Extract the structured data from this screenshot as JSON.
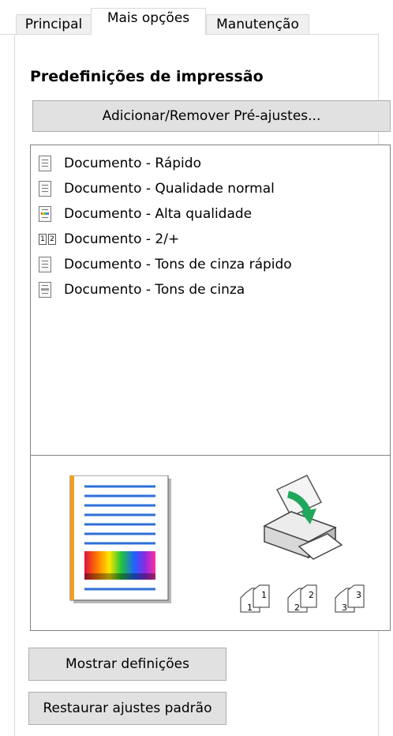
{
  "tabs": [
    {
      "label": "Principal",
      "active": false
    },
    {
      "label": "Mais opções",
      "active": true
    },
    {
      "label": "Manutenção",
      "active": false
    }
  ],
  "presets": {
    "title": "Predefinições de impressão",
    "add_remove_label": "Adicionar/Remover Pré-ajustes...",
    "items": [
      {
        "label": "Documento - Rápido",
        "icon": "document-icon"
      },
      {
        "label": "Documento - Qualidade normal",
        "icon": "document-icon"
      },
      {
        "label": "Documento - Alta qualidade",
        "icon": "document-color-icon"
      },
      {
        "label": "Documento - 2/+",
        "icon": "two-up-icon"
      },
      {
        "label": "Documento - Tons de cinza rápido",
        "icon": "document-gray-icon"
      },
      {
        "label": "Documento - Tons de cinza",
        "icon": "document-gray-icon"
      }
    ],
    "preview": {
      "page_icon": "page-preview-icon",
      "printer_icon": "printer-icon",
      "collate_labels": [
        "1",
        "1",
        "2",
        "2",
        "3",
        "3"
      ]
    }
  },
  "buttons": {
    "show_settings": "Mostrar definições",
    "restore_defaults": "Restaurar ajustes padrão"
  },
  "colors": {
    "accent_blue": "#2f6fd6",
    "page_border_orange": "#f0a020",
    "button_bg": "#e1e1e1",
    "arrow_green": "#1fa85c"
  }
}
